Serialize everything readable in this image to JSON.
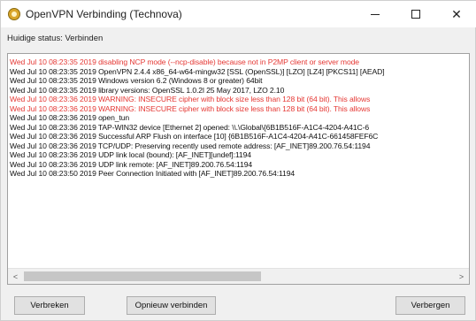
{
  "window": {
    "title": "OpenVPN Verbinding (Technova)",
    "controls": {
      "minimize": "—",
      "close": "✕"
    }
  },
  "status": {
    "text": "Huidige status: Verbinden"
  },
  "log": {
    "lines": [
      {
        "text": "Wed Jul 10 08:23:35 2019 disabling NCP mode (--ncp-disable) because not in P2MP client or server mode",
        "level": "warn"
      },
      {
        "text": "Wed Jul 10 08:23:35 2019 OpenVPN 2.4.4 x86_64-w64-mingw32 [SSL (OpenSSL)] [LZO] [LZ4] [PKCS11] [AEAD]",
        "level": "info"
      },
      {
        "text": "Wed Jul 10 08:23:35 2019 Windows version 6.2 (Windows 8 or greater) 64bit",
        "level": "info"
      },
      {
        "text": "Wed Jul 10 08:23:35 2019 library versions: OpenSSL 1.0.2l  25 May 2017, LZO 2.10",
        "level": "info"
      },
      {
        "text": "Wed Jul 10 08:23:36 2019 WARNING: INSECURE cipher with block size less than 128 bit (64 bit).  This allows",
        "level": "warn"
      },
      {
        "text": "Wed Jul 10 08:23:36 2019 WARNING: INSECURE cipher with block size less than 128 bit (64 bit).  This allows",
        "level": "warn"
      },
      {
        "text": "Wed Jul 10 08:23:36 2019 open_tun",
        "level": "info"
      },
      {
        "text": "Wed Jul 10 08:23:36 2019 TAP-WIN32 device [Ethernet 2] opened: \\\\.\\Global\\{6B1B516F-A1C4-4204-A41C-6",
        "level": "info"
      },
      {
        "text": "Wed Jul 10 08:23:36 2019 Successful ARP Flush on interface [10] {6B1B516F-A1C4-4204-A41C-661458FEF6C",
        "level": "info"
      },
      {
        "text": "Wed Jul 10 08:23:36 2019 TCP/UDP: Preserving recently used remote address: [AF_INET]89.200.76.54:1194",
        "level": "info"
      },
      {
        "text": "Wed Jul 10 08:23:36 2019 UDP link local (bound): [AF_INET][undef]:1194",
        "level": "info"
      },
      {
        "text": "Wed Jul 10 08:23:36 2019 UDP link remote: [AF_INET]89.200.76.54:1194",
        "level": "info"
      },
      {
        "text": "Wed Jul 10 08:23:50 2019 Peer Connection Initiated with [AF_INET]89.200.76.54:1194",
        "level": "info"
      }
    ]
  },
  "scrollbar": {
    "left_arrow": "<",
    "right_arrow": ">"
  },
  "buttons": {
    "disconnect": "Verbreken",
    "reconnect": "Opnieuw verbinden",
    "hide": "Verbergen"
  },
  "colors": {
    "warning_text": "#e53935",
    "info_text": "#111111"
  }
}
